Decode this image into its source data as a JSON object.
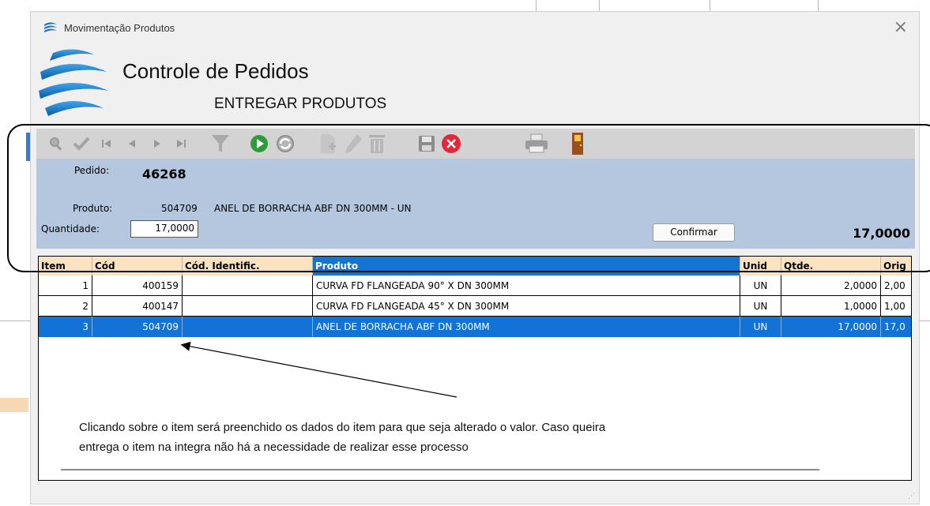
{
  "window": {
    "title": "Movimentação Produtos",
    "close_icon": "×"
  },
  "header": {
    "title": "Controle de Pedidos",
    "subtitle": "ENTREGAR PRODUTOS"
  },
  "toolbar": {
    "icons": [
      "search-icon",
      "check-icon",
      "first-record-icon",
      "prev-record-icon",
      "next-record-icon",
      "last-record-icon",
      "filter-icon",
      "play-icon",
      "refresh-icon",
      "new-record-icon",
      "edit-icon",
      "delete-icon",
      "save-icon",
      "cancel-icon",
      "print-icon",
      "exit-door-icon"
    ],
    "colors": {
      "active_green": "#2e9a3a",
      "cancel_red": "#e4283c",
      "door_brown": "#9b4f1c",
      "disabled_gray": "#a4a4a4"
    }
  },
  "form": {
    "pedido_label": "Pedido:",
    "pedido_value": "46268",
    "produto_label": "Produto:",
    "produto_code": "504709",
    "produto_desc": "ANEL DE BORRACHA ABF DN 300MM - UN",
    "quantidade_label": "Quantidade:",
    "quantidade_value": "17,0000",
    "confirm_label": "Confirmar",
    "total": "17,0000"
  },
  "grid": {
    "columns": [
      "Item",
      "Cód",
      "Cód. Identific.",
      "Produto",
      "Unid",
      "Qtde.",
      "Orig"
    ],
    "active_column": "Produto",
    "rows": [
      {
        "item": "1",
        "cod": "400159",
        "cod_ident": "",
        "produto": "CURVA FD FLANGEADA 90° X DN 300MM",
        "unid": "UN",
        "qtde": "2,0000",
        "orig": "2,00"
      },
      {
        "item": "2",
        "cod": "400147",
        "cod_ident": "",
        "produto": "CURVA FD FLANGEADA 45° X DN 300MM",
        "unid": "UN",
        "qtde": "1,0000",
        "orig": "1,00"
      },
      {
        "item": "3",
        "cod": "504709",
        "cod_ident": "",
        "produto": "ANEL DE BORRACHA ABF DN 300MM",
        "unid": "UN",
        "qtde": "17,0000",
        "orig": "17,0"
      }
    ],
    "selected_row": 3
  },
  "annotation": {
    "line1": "Clicando sobre o item será preenchido os dados do item para que seja alterado o valor. Caso queira",
    "line2": "entrega o item na integra não há a necessidade de realizar esse processo"
  },
  "colors": {
    "panel_blue": "#b4c7de",
    "header_orange": "#fbe3c2",
    "selection_blue": "#1272d6"
  }
}
